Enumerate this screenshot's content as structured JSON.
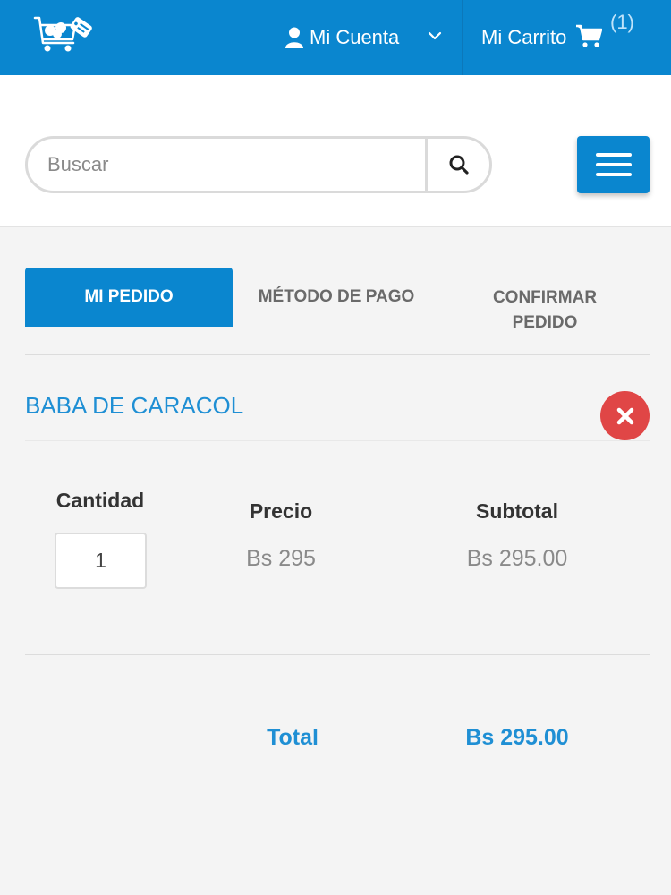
{
  "header": {
    "account_label": "Mi Cuenta",
    "cart_label": "Mi Carrito",
    "cart_count": "(1)",
    "icons": [
      "logo-cart-icon",
      "user-icon",
      "chevron-down-icon",
      "shopping-cart-icon"
    ]
  },
  "search": {
    "placeholder": "Buscar",
    "value": ""
  },
  "steps": [
    {
      "label": "MI PEDIDO",
      "active": true
    },
    {
      "label": "MÉTODO DE PAGO",
      "active": false
    },
    {
      "label": "CONFIRMAR PEDIDO",
      "active": false
    }
  ],
  "order": {
    "product_name": "BABA DE CARACOL",
    "columns": {
      "quantity": "Cantidad",
      "price": "Precio",
      "subtotal": "Subtotal"
    },
    "quantity": "1",
    "price": "Bs 295",
    "subtotal": "Bs 295.00",
    "total_label": "Total",
    "total_value": "Bs 295.00"
  },
  "colors": {
    "primary": "#0a86cf",
    "accent_text": "#1f8fd4",
    "remove": "#e04646",
    "background": "#f4f4f4"
  }
}
